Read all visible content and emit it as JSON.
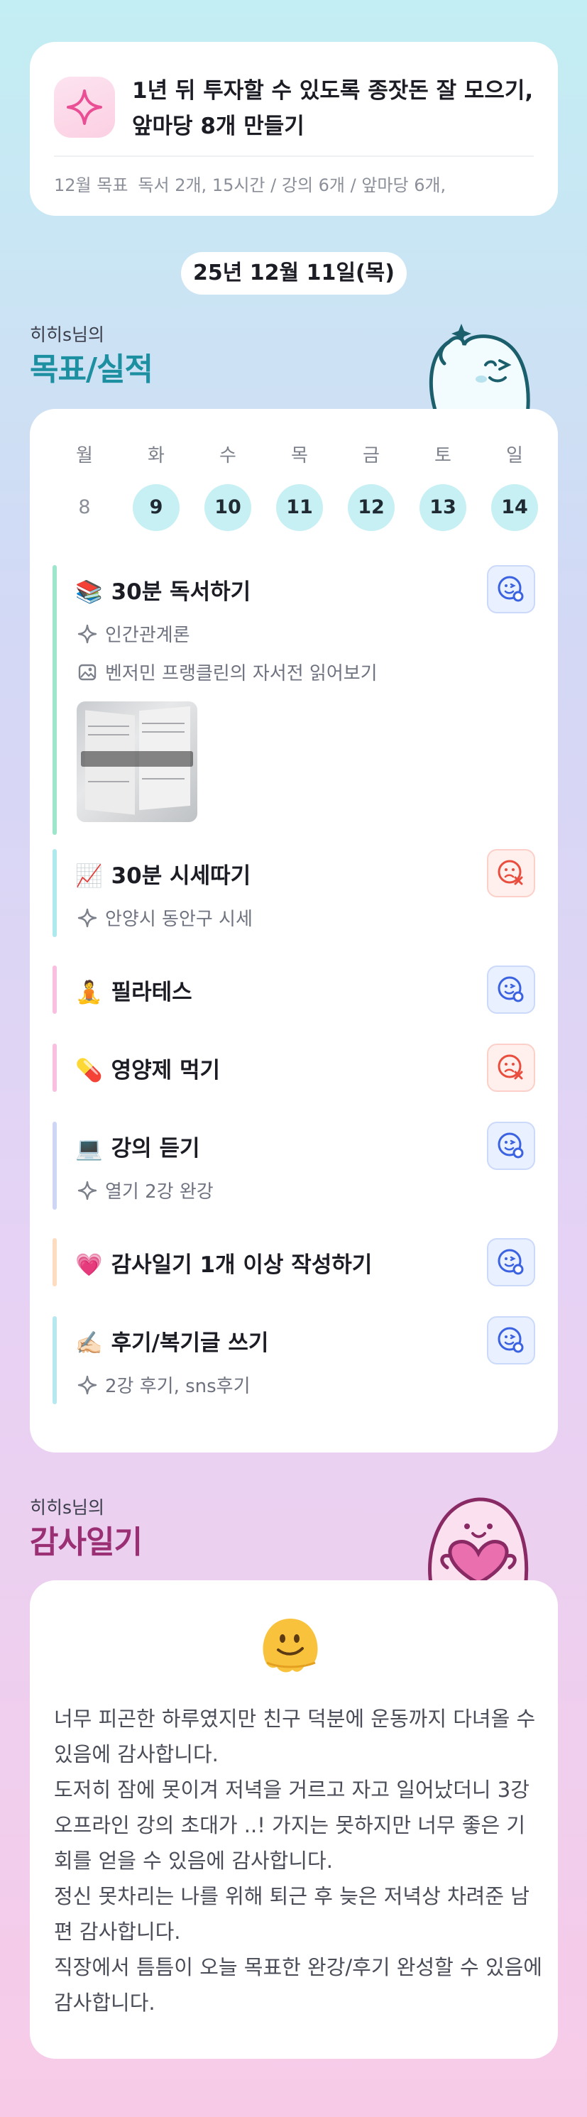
{
  "goal": {
    "text": "1년 뒤 투자할 수 있도록 종잣돈 잘 모으기, 앞마당 8개 만들기",
    "month_label": "12월 목표",
    "month_text": "독서 2개, 15시간 / 강의 6개 / 앞마당 6개,"
  },
  "date": "25년 12월 11일(목)",
  "goals_section": {
    "subtitle": "히히s님의",
    "title": "목표/실적"
  },
  "week": {
    "weekdays": [
      "월",
      "화",
      "수",
      "목",
      "금",
      "토",
      "일"
    ],
    "days": [
      "8",
      "9",
      "10",
      "11",
      "12",
      "13",
      "14"
    ]
  },
  "tasks": [
    {
      "emoji": "📚",
      "title": "30분 독서하기",
      "status": "good",
      "bar_color": "#9ee6cb",
      "lines": [
        {
          "icon": "sparkle-icon",
          "text": "인간관계론"
        },
        {
          "icon": "image-icon",
          "text": "벤저민 프랭클린의 자서전 읽어보기"
        }
      ],
      "photo": "book-photo"
    },
    {
      "emoji": "📈",
      "title": "30분 시세따기",
      "status": "bad",
      "bar_color": "#aee9ee",
      "lines": [
        {
          "icon": "sparkle-icon",
          "text": "안양시 동안구 시세"
        }
      ]
    },
    {
      "emoji": "🧘",
      "title": "필라테스",
      "status": "good",
      "bar_color": "#f8bfe0",
      "lines": []
    },
    {
      "emoji": "💊",
      "title": "영양제 먹기",
      "status": "bad",
      "bar_color": "#f8bfe0",
      "lines": []
    },
    {
      "emoji": "💻",
      "title": "강의 듣기",
      "status": "good",
      "bar_color": "#cdd6f5",
      "lines": [
        {
          "icon": "sparkle-icon",
          "text": "열기 2강 완강"
        }
      ]
    },
    {
      "emoji": "💗",
      "title": "감사일기 1개 이상 작성하기",
      "status": "good",
      "bar_color": "#fddcc0",
      "lines": []
    },
    {
      "emoji": "✍🏻",
      "title": "후기/복기글 쓰기",
      "status": "good",
      "bar_color": "#b7e8f0",
      "lines": [
        {
          "icon": "sparkle-icon",
          "text": "2강 후기, sns후기"
        }
      ]
    }
  ],
  "thanks_section": {
    "subtitle": "히히s님의",
    "title": "감사일기"
  },
  "diary": {
    "emoji": "melting-face",
    "text": "너무 피곤한 하루였지만 친구 덕분에 운동까지 다녀올 수 있음에 감사합니다.\n도저히 잠에 못이겨 저녁을 거르고 자고 일어났더니 3강 오프라인 강의 초대가 ..! 가지는 못하지만 너무 좋은 기회를 얻을 수 있음에 감사합니다.\n정신 못차리는 나를 위해 퇴근 후 늦은 저녁상 차려준 남편 감사합니다.\n직장에서 틈틈이 오늘 목표한 완강/후기 완성할 수 있음에 감사합니다."
  },
  "colors": {
    "accent_teal": "#1c8fa0",
    "accent_magenta": "#9a2f73",
    "day_circle": "#c6f0f3"
  }
}
